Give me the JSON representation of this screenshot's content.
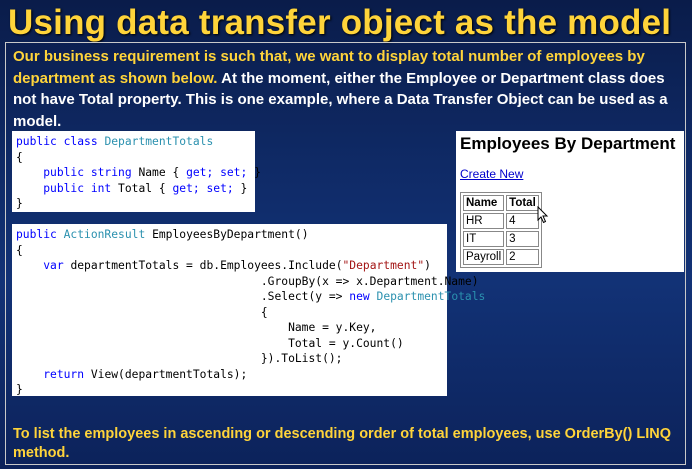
{
  "slide": {
    "title": "Using data transfer object as the model",
    "intro_highlight": "Our business requirement is such that, we want to display total number of employees by department as shown below.",
    "intro_rest": "At the moment, either the Employee or Department class does not have Total property. This is one example, where a Data Transfer Object can be used as a model.",
    "footer": "To list the employees in ascending  or descending order of total employees, use OrderBy() LINQ method."
  },
  "code1": {
    "lines": [
      [
        "public class ",
        "DepartmentTotals"
      ],
      [
        "{"
      ],
      [
        "    public string Name { get; set; }"
      ],
      [
        "    public int Total { get; set; }"
      ],
      [
        "}"
      ]
    ],
    "text": {
      "l1a": "public class",
      "l1b": "DepartmentTotals",
      "l2": "{",
      "l3a": "public string",
      "l3b": "Name {",
      "l3c": "get; set;",
      "l3d": "}",
      "l4a": "public int",
      "l4b": "Total {",
      "l4c": "get; set;",
      "l4d": "}",
      "l5": "}"
    }
  },
  "code2": {
    "text": {
      "l1a": "public",
      "l1b": "ActionResult",
      "l1c": "EmployeesByDepartment()",
      "l2": "{",
      "l3a": "var",
      "l3b": "departmentTotals = db.Employees.Include(",
      "l3c": "\"Department\"",
      "l3d": ")",
      "l4": ".GroupBy(x => x.Department.Name)",
      "l5a": ".Select(y =>",
      "l5b": "new",
      "l5c": "DepartmentTotals",
      "l6": "{",
      "l7": "Name = y.Key,",
      "l8": "Total = y.Count()",
      "l9": "}).ToList();",
      "l10a": "return",
      "l10b": "View(departmentTotals);",
      "l11": "}"
    }
  },
  "browser": {
    "heading": "Employees By Department",
    "link": "Create New",
    "columns": [
      "Name",
      "Total"
    ],
    "rows": [
      [
        "HR",
        "4"
      ],
      [
        "IT",
        "3"
      ],
      [
        "Payroll",
        "2"
      ]
    ]
  },
  "colors": {
    "title": "#ffd43a",
    "keyword": "#0000ff",
    "type": "#2b91af",
    "string": "#a31515"
  },
  "icons": [
    "mouse-cursor-icon"
  ]
}
